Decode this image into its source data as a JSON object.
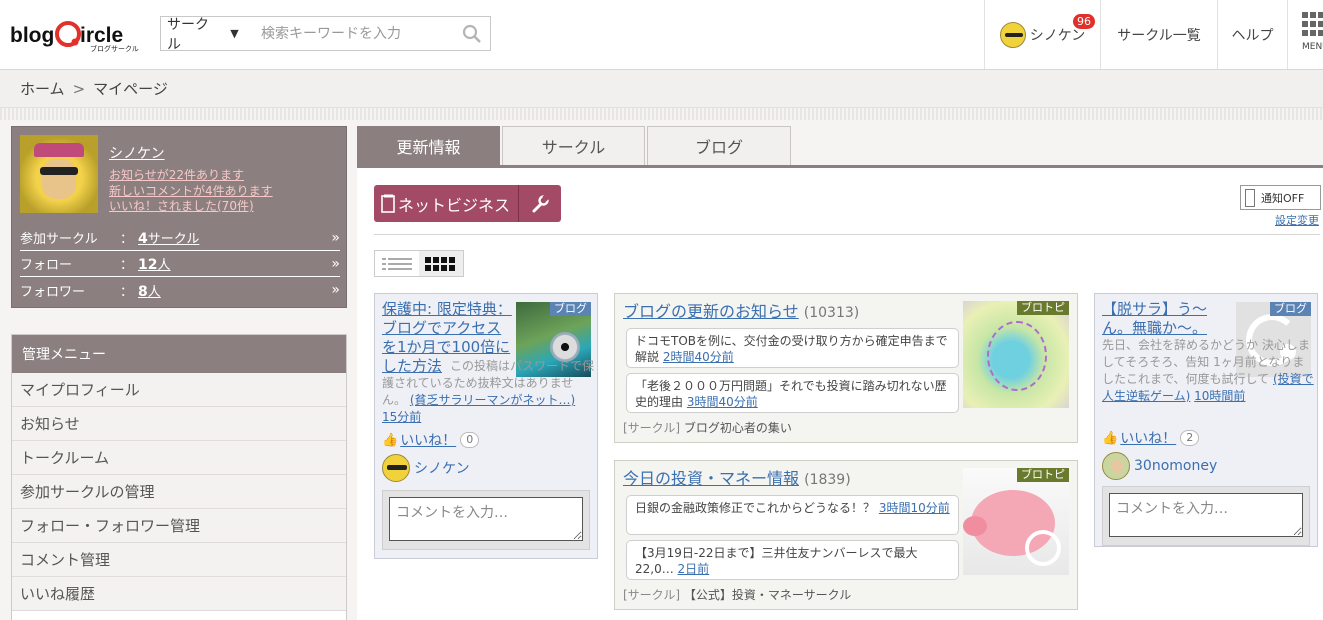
{
  "header": {
    "logo_text": "blogcircle",
    "logo_sub": "ブログサークル",
    "search": {
      "scope": "サークル",
      "placeholder": "検索キーワードを入力"
    },
    "user": {
      "name": "シノケン",
      "badge": "96"
    },
    "nav": {
      "circle_list": "サークル一覧",
      "help": "ヘルプ",
      "menu": "MENU"
    }
  },
  "breadcrumb": {
    "home": "ホーム",
    "sep": ">",
    "current": "マイページ"
  },
  "profile": {
    "name": "シノケン",
    "notices": [
      "お知らせが22件あります",
      "新しいコメントが4件あります",
      "いいね！されました(70件)"
    ],
    "stats": [
      {
        "label": "参加サークル",
        "sep": "：",
        "num": "4",
        "unit": "サークル"
      },
      {
        "label": "フォロー",
        "sep": "：",
        "num": "12",
        "unit": "人"
      },
      {
        "label": "フォロワー",
        "sep": "：",
        "num": "8",
        "unit": "人"
      }
    ]
  },
  "menu": {
    "title": "管理メニュー",
    "items": [
      "マイプロフィール",
      "お知らせ",
      "トークルーム",
      "参加サークルの管理",
      "フォロー・フォロワー管理",
      "コメント管理",
      "いいね履歴"
    ]
  },
  "tabs": [
    "更新情報",
    "サークル",
    "ブログ"
  ],
  "circle_button": "ネットビジネス",
  "notify": {
    "toggle": "通知OFF",
    "settings": "設定変更"
  },
  "cards": {
    "c1": {
      "tag": "ブログ",
      "title": "保護中: 限定特典：ブログでアクセスを1か月で100倍にした方法",
      "body": "この投稿はパスワードで保護されているため抜粋文はありません。",
      "source": "(貧乏サラリーマンがネット…)",
      "time": "15分前",
      "like_label": "いいね！",
      "like_count": "0",
      "author": "シノケン",
      "comment_placeholder": "コメントを入力…"
    },
    "c2": {
      "tag": "ブロトピ",
      "title": "ブログの更新のお知らせ",
      "count": "(10313)",
      "posts": [
        {
          "text": "ドコモTOBを例に、交付金の受け取り方から確定申告まで解説",
          "time": "2時間40分前"
        },
        {
          "text": "「老後２０００万円問題」それでも投資に踏み切れない歴史的理由",
          "time": "3時間40分前"
        }
      ],
      "footer_type": "[サークル]",
      "footer_name": "ブログ初心者の集い"
    },
    "c3": {
      "tag": "ブログ",
      "title": "【脱サラ】う〜ん。無職か〜。",
      "body": "先日、会社を辞めるかどうか 決心しましてそろそろ、告知 1ヶ月前となりましたこれまで、何度も試行して",
      "source": "(投資で人生逆転ゲーム)",
      "time": "10時間前",
      "like_label": "いいね！",
      "like_count": "2",
      "author": "30nomoney",
      "comment_placeholder": "コメントを入力…"
    },
    "c4": {
      "tag": "ブロトピ",
      "title": "今日の投資・マネー情報",
      "count": "(1839)",
      "posts": [
        {
          "text": "日銀の金融政策修正でこれからどうなる！？",
          "time": "3時間10分前"
        },
        {
          "text": "【3月19日-22日まで】三井住友ナンバーレスで最大22,0…",
          "time": "2日前"
        }
      ],
      "footer_type": "[サークル]",
      "footer_name": "【公式】投資・マネーサークル"
    }
  },
  "colors": {
    "brand": "#8b7f7f",
    "accent": "#a34a66",
    "link": "#3a6fb0",
    "logo_red": "#e2312a"
  }
}
